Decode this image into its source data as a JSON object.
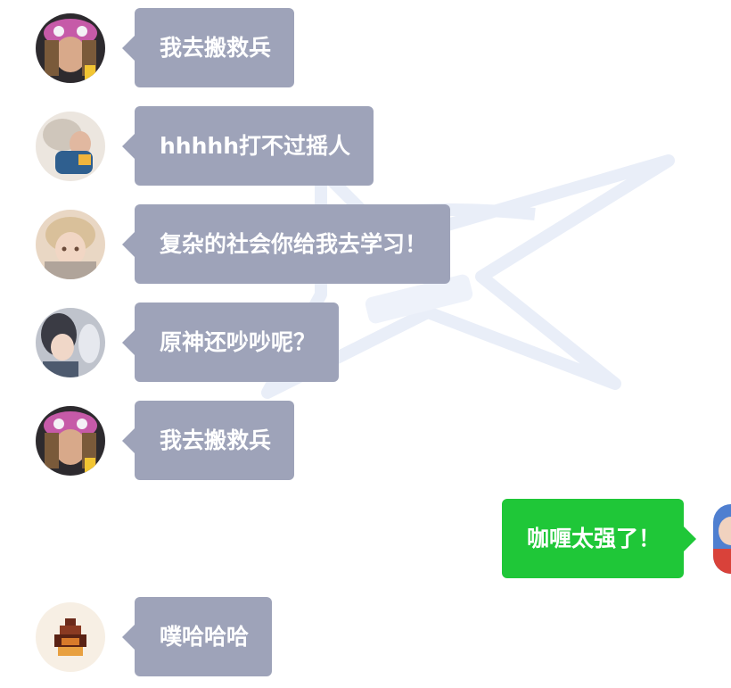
{
  "colors": {
    "incoming_bubble": "#9ea3b9",
    "outgoing_bubble": "#1fc738",
    "bubble_text": "#ffffff",
    "background": "#ffffff",
    "watermark": "#e9eef8"
  },
  "messages": [
    {
      "side": "left",
      "avatar": "avatar-pink-hat-girl",
      "text": "我去搬救兵"
    },
    {
      "side": "left",
      "avatar": "avatar-white-haired-character",
      "text": "hhhhh打不过摇人"
    },
    {
      "side": "left",
      "avatar": "avatar-blonde-character",
      "text": "复杂的社会你给我去学习！"
    },
    {
      "side": "left",
      "avatar": "avatar-dark-haired-character",
      "text": "原神还吵吵呢？"
    },
    {
      "side": "left",
      "avatar": "avatar-pink-hat-girl",
      "text": "我去搬救兵"
    },
    {
      "side": "right",
      "avatar": "avatar-self",
      "text": "咖喱太强了！"
    },
    {
      "side": "left",
      "avatar": "avatar-pixel-fire",
      "text": "噗哈哈哈"
    }
  ]
}
